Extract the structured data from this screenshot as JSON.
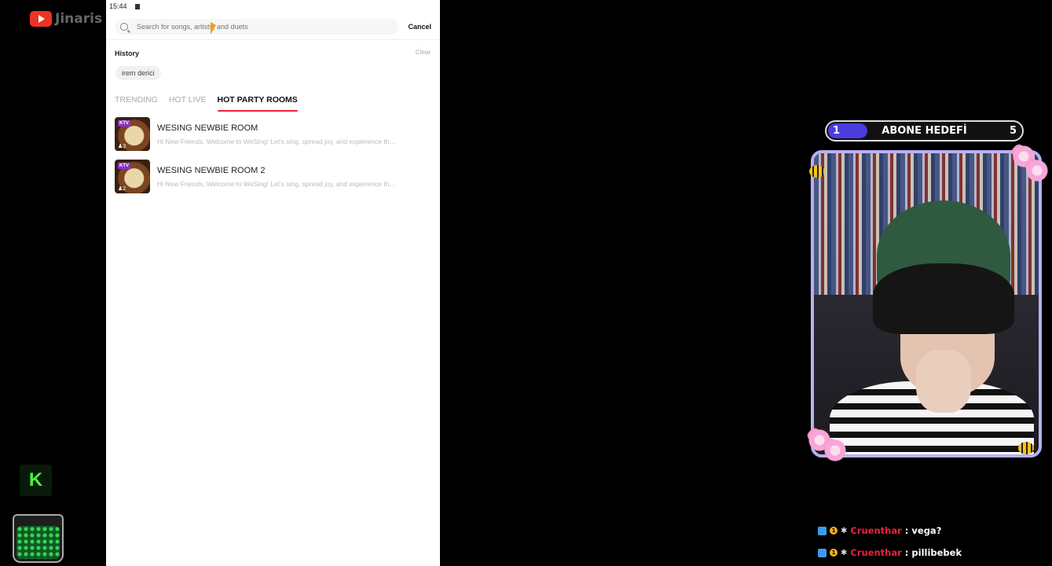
{
  "brand": {
    "name": "Jinaris"
  },
  "phone": {
    "status_time": "15:44",
    "search": {
      "placeholder": "Search for songs, artists, and duets",
      "cancel_label": "Cancel"
    },
    "history": {
      "title": "History",
      "clear_label": "Clear",
      "chips": [
        "irem derici"
      ]
    },
    "tabs": [
      {
        "label": "TRENDING",
        "active": false
      },
      {
        "label": "HOT LIVE",
        "active": false
      },
      {
        "label": "HOT PARTY ROOMS",
        "active": true
      }
    ],
    "rooms": [
      {
        "title": "WESING NEWBIE ROOM",
        "description": "Hi New Friends, Welcome to WeSing! Let's sing, spread joy, and experience th...",
        "badge": "KTV",
        "count": "3"
      },
      {
        "title": "WESING NEWBIE ROOM 2",
        "description": "Hi New Friends, Welcome to WeSing! Let's sing, spread joy, and experience th...",
        "badge": "KTV",
        "count": "2"
      }
    ]
  },
  "overlay": {
    "k_label": "K",
    "goal": {
      "label": "ABONE HEDEFİ",
      "current": "1",
      "target": "5",
      "progress": 0.2
    },
    "chat": [
      {
        "badge_level": "1",
        "user": "Cruenthar",
        "message": ": vega?"
      },
      {
        "badge_level": "1",
        "user": "Cruenthar",
        "message": ": pillibebek"
      }
    ]
  },
  "colors": {
    "accent_red": "#e8223c",
    "goal_fill": "#4a3de0",
    "frame": "#b9b0f0"
  }
}
